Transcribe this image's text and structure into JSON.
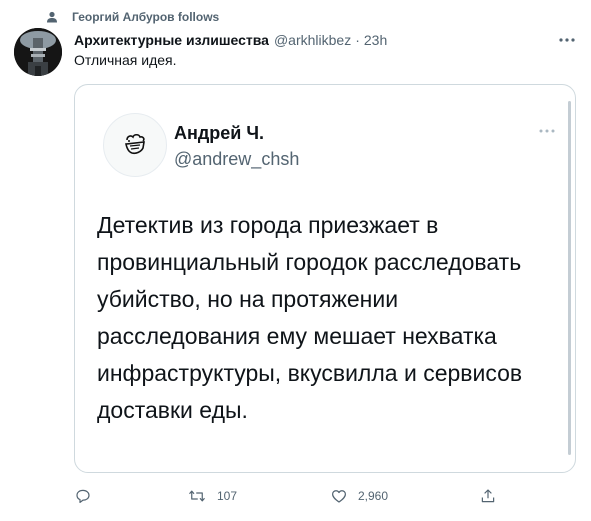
{
  "context": {
    "text": "Георгий Албуров follows"
  },
  "tweet": {
    "author": "Архитектурные излишества",
    "handle": "@arkhlikbez",
    "separator": "·",
    "time": "23h",
    "text": "Отличная идея."
  },
  "quote": {
    "author": "Андрей Ч.",
    "handle": "@andrew_chsh",
    "text": "Детектив из города приезжает в провинциальный городок расследовать убийство, но на протяжении расследования ему мешает нехватка инфраструктуры, вкусвилла и сервисов доставки еды."
  },
  "actions": {
    "reply_count": "",
    "retweet_count": "107",
    "like_count": "2,960"
  },
  "icons": {
    "context": "person-icon",
    "reply": "reply-icon",
    "retweet": "retweet-icon",
    "like": "heart-icon",
    "share": "share-icon",
    "more": "more-icon"
  },
  "colors": {
    "text": "#0f1419",
    "secondary": "#536471",
    "border": "#cfd9de"
  }
}
